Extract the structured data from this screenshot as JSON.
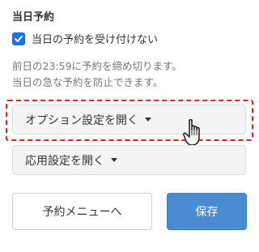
{
  "section": {
    "title": "当日予約"
  },
  "checkbox": {
    "label": "当日の予約を受け付けない",
    "checked": true,
    "color": "#1a73e8"
  },
  "note": {
    "line1": "前日の23:59に予約を締め切ります。",
    "line2": "当日の急な予約を防止できます。"
  },
  "toggles": {
    "options_label": "オプション設定を開く",
    "advanced_label": "応用設定を開く"
  },
  "actions": {
    "menu_label": "予約メニューへ",
    "save_label": "保存"
  },
  "colors": {
    "highlight": "#d7262b",
    "save_button": "#4a8cd2"
  }
}
